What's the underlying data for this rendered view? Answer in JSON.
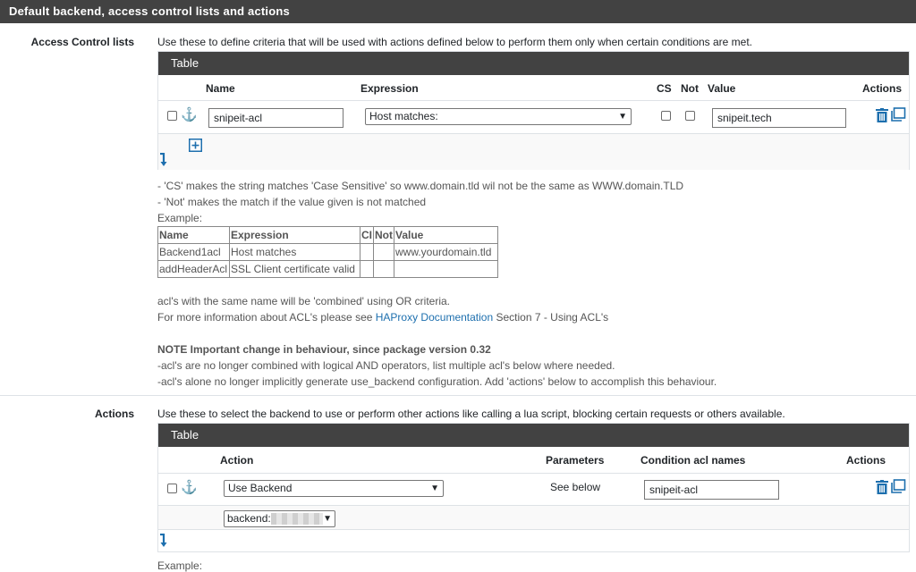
{
  "section_title": "Default backend, access control lists and actions",
  "acl": {
    "label": "Access Control lists",
    "description": "Use these to define criteria that will be used with actions defined below to perform them only when certain conditions are met.",
    "table_title": "Table",
    "columns": {
      "name": "Name",
      "expression": "Expression",
      "cs": "CS",
      "not": "Not",
      "value": "Value",
      "actions": "Actions"
    },
    "row": {
      "name": "snipeit-acl",
      "expression": "Host matches:",
      "value": "snipeit.tech"
    },
    "help_cs": "- 'CS' makes the string matches 'Case Sensitive' so www.domain.tld wil not be the same as WWW.domain.TLD",
    "help_not": "- 'Not' makes the match if the value given is not matched",
    "example_label": "Example:",
    "example_table": {
      "headers": [
        "Name",
        "Expression",
        "CI",
        "Not",
        "Value"
      ],
      "rows": [
        [
          "Backend1acl",
          "Host matches",
          "",
          "",
          "www.yourdomain.tld"
        ],
        [
          "addHeaderAcl",
          "SSL Client certificate valid",
          "",
          "",
          ""
        ]
      ]
    },
    "combined_note": "acl's with the same name will be 'combined' using OR criteria.",
    "more_info_prefix": "For more information about ACL's please see ",
    "more_info_link": "HAProxy Documentation",
    "more_info_suffix": " Section 7 - Using ACL's",
    "note_title": "NOTE Important change in behaviour, since package version 0.32",
    "note_line1": "-acl's are no longer combined with logical AND operators, list multiple acl's below where needed.",
    "note_line2": "-acl's alone no longer implicitly generate use_backend configuration. Add 'actions' below to accomplish this behaviour."
  },
  "actions": {
    "label": "Actions",
    "description": "Use these to select the backend to use or perform other actions like calling a lua script, blocking certain requests or others available.",
    "table_title": "Table",
    "columns": {
      "action": "Action",
      "parameters": "Parameters",
      "condition": "Condition acl names",
      "actions": "Actions"
    },
    "row": {
      "action": "Use Backend",
      "parameters": "See below",
      "condition": "snipeit-acl"
    },
    "backend_label": "backend:",
    "example_label": "Example:"
  },
  "colors": {
    "header_bg": "#424242",
    "link": "#1d6fae"
  }
}
